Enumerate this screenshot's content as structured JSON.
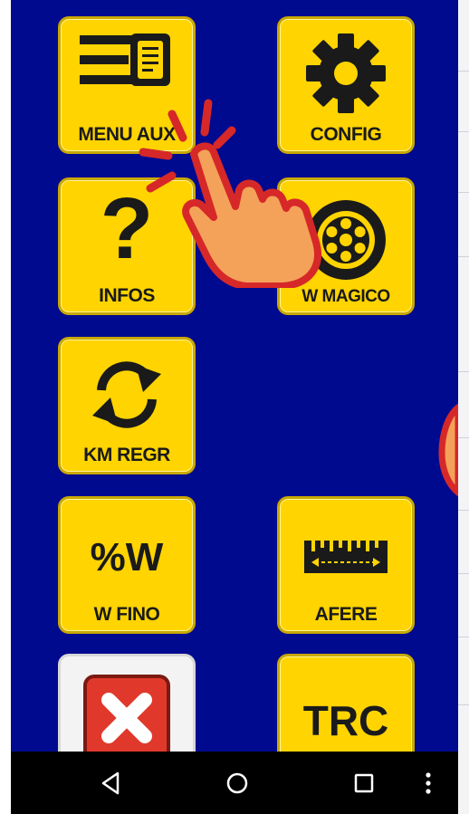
{
  "tiles": {
    "menu_aux": {
      "label": "MENU AUX",
      "icon": "menu-list-icon"
    },
    "config": {
      "label": "CONFIG",
      "icon": "gear-icon"
    },
    "infos": {
      "label": "INFOS",
      "icon": "question-mark-icon",
      "glyph": "?"
    },
    "w_magico": {
      "label": "W MAGICO",
      "icon": "wheel-icon"
    },
    "km_regr": {
      "label": "KM REGR",
      "icon": "refresh-cycle-icon"
    },
    "w_fino": {
      "label": "W FINO",
      "text": "%W"
    },
    "afere": {
      "label": "AFERE",
      "icon": "ruler-icon"
    },
    "close": {
      "icon": "close-x-icon"
    },
    "trc": {
      "text": "TRC"
    }
  },
  "overlay": {
    "icon": "tap-hand-icon"
  },
  "navbar": {
    "back": "back-triangle-icon",
    "home": "home-circle-icon",
    "recents": "recents-square-icon",
    "more": "more-vertical-icon"
  },
  "colors": {
    "screen_bg": "#000a8f",
    "tile_yellow": "#ffd400",
    "tile_border": "#c9a800",
    "close_red": "#e0392b",
    "hand_orange": "#f4a259",
    "hand_outline": "#d62828"
  }
}
